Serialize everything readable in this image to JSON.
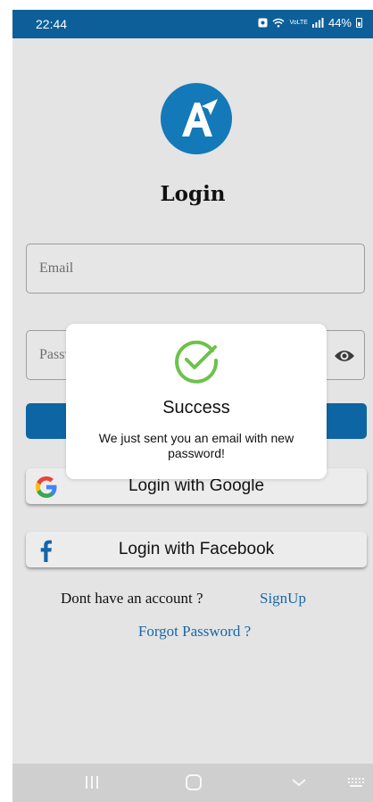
{
  "status_bar": {
    "time": "22:44",
    "network_label": "VoLTE",
    "battery": "44%"
  },
  "login": {
    "title": "Login",
    "email_placeholder": "Email",
    "password_placeholder": "Password",
    "google_label": "Login with Google",
    "facebook_label": "Login with Facebook",
    "no_account_text": "Dont have an account ?",
    "signup_label": "SignUp",
    "forgot_label": "Forgot Password ?"
  },
  "modal": {
    "title": "Success",
    "message": "We just sent you an email with new password!"
  },
  "colors": {
    "status_bar": "#0c5f98",
    "primary": "#0e65a4",
    "link": "#1967a8",
    "success": "#6cc24a"
  },
  "icons": {
    "logo": "app-logo-a-icon",
    "eye": "eye-icon",
    "google": "google-logo-icon",
    "facebook": "facebook-logo-icon",
    "success": "check-circle-icon"
  }
}
